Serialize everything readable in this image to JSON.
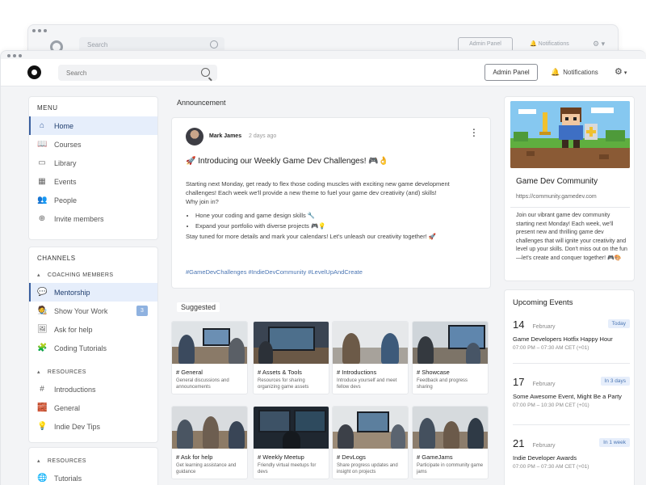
{
  "background_window": {
    "search_placeholder": "Search",
    "admin_label": "Admin Panel",
    "notifications_label": "Notifications"
  },
  "topbar": {
    "search_placeholder": "Search",
    "admin_label": "Admin Panel",
    "notifications_label": "Notifications"
  },
  "menu": {
    "title": "MENU",
    "items": [
      {
        "label": "Home",
        "icon": "home-icon",
        "active": true
      },
      {
        "label": "Courses",
        "icon": "book-icon"
      },
      {
        "label": "Library",
        "icon": "library-icon"
      },
      {
        "label": "Events",
        "icon": "calendar-icon"
      },
      {
        "label": "People",
        "icon": "people-icon"
      },
      {
        "label": "Invite members",
        "icon": "add-user-icon"
      }
    ]
  },
  "channels": {
    "title": "CHANNELS",
    "groups": [
      {
        "title": "COACHING MEMBERS",
        "items": [
          {
            "label": "Mentorship",
            "active": true
          },
          {
            "label": "Show Your Work",
            "badge": "3"
          },
          {
            "label": "Ask for help"
          },
          {
            "label": "Coding Tutorials"
          }
        ]
      },
      {
        "title": "RESOURCES",
        "items": [
          {
            "label": "Introductions"
          },
          {
            "label": "General"
          },
          {
            "label": "Indie Dev Tips"
          }
        ]
      }
    ]
  },
  "resources": {
    "title": "RESOURCES",
    "items": [
      {
        "label": "Tutorials"
      }
    ]
  },
  "announcement": {
    "section_label": "Announcement",
    "author": "Mark James",
    "time": "2 days ago",
    "title": "🚀 Introducing our Weekly Game Dev Challenges! 🎮👌",
    "intro": "Starting next Monday, get ready to flex those coding muscles with exciting new game development challenges! Each week we'll provide a new theme to fuel your game dev creativity (and) skills!",
    "why": "Why join in?",
    "bullets": [
      "Hone your coding and game design skills 🔧",
      "Expand your portfolio with diverse projects 🎮💡"
    ],
    "outro": "Stay tuned for more details and mark your calendars! Let's unleash our creativity together! 🚀",
    "hashtags": "#GameDevChallenges #IndieDevCommunity #LevelUpAndCreate"
  },
  "suggested": {
    "section_label": "Suggested",
    "cards": [
      {
        "name": "# General",
        "desc": "General discussions and announcements"
      },
      {
        "name": "# Assets & Tools",
        "desc": "Resources for sharing organizing game assets"
      },
      {
        "name": "# Introductions",
        "desc": "Introduce yourself and meet fellow devs"
      },
      {
        "name": "# Showcase",
        "desc": "Feedback and progress sharing"
      },
      {
        "name": "# Ask for help",
        "desc": "Get learning assistance and guidance"
      },
      {
        "name": "# Weekly Meetup",
        "desc": "Friendly virtual meetups for devs"
      },
      {
        "name": "# DevLogs",
        "desc": "Share progress updates and insight on projects"
      },
      {
        "name": "# GameJams",
        "desc": "Participate in community game jams"
      }
    ]
  },
  "community": {
    "title": "Game Dev Community",
    "url": "https://community.gamedev.com",
    "description": "Join our vibrant game dev community starting next Monday! Each week, we'll present new and thrilling game dev challenges that will ignite your creativity and level up your skills. Don't miss out on the fun—let's create and conquer together! 🎮🎨"
  },
  "events": {
    "title": "Upcoming Events",
    "items": [
      {
        "day": "14",
        "month": "February",
        "when": "Today",
        "name": "Game Developers Hotfix Happy Hour",
        "time": "07:00 PM – 07:30 AM CET (+01)"
      },
      {
        "day": "17",
        "month": "February",
        "when": "In 3 days",
        "name": "Some Awesome Event, Might Be a Party",
        "time": "07:00 PM – 10:30 PM CET (+01)"
      },
      {
        "day": "21",
        "month": "February",
        "when": "In 1 week",
        "name": "Indie Developer Awards",
        "time": "07:00 PM – 07:30 AM CET (+01)"
      }
    ]
  }
}
